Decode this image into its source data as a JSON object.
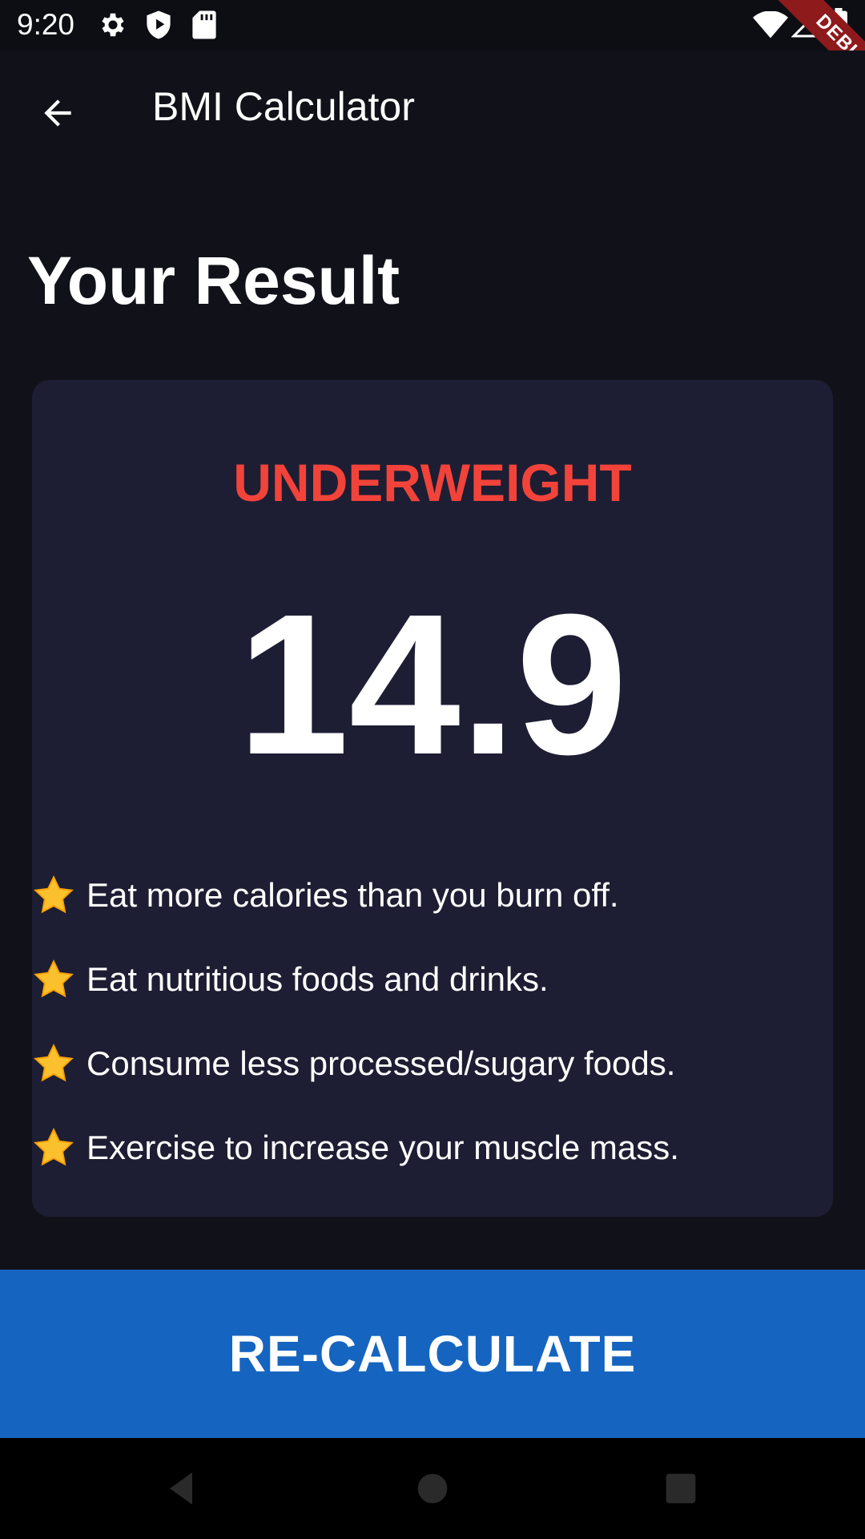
{
  "status_bar": {
    "time": "9:20",
    "left_icons": [
      "settings-icon",
      "shield-icon",
      "sd-card-icon"
    ],
    "right_icons": [
      "wifi-icon",
      "signal-icon",
      "battery-icon"
    ]
  },
  "debug_banner": {
    "label": "DEBUG",
    "color": "#8e1a1c"
  },
  "app_bar": {
    "back_icon": "arrow-back-icon",
    "title": "BMI Calculator"
  },
  "result": {
    "heading": "Your Result",
    "status": "UNDERWEIGHT",
    "status_color": "#f2433a",
    "bmi": "14.9",
    "advice": [
      {
        "icon": "star-icon",
        "text": "Eat more calories than you burn off."
      },
      {
        "icon": "star-icon",
        "text": "Eat nutritious foods and drinks."
      },
      {
        "icon": "star-icon",
        "text": "Consume less processed/sugary foods."
      },
      {
        "icon": "star-icon",
        "text": "Exercise to increase your muscle mass."
      }
    ]
  },
  "recalculate_button": {
    "label": "RE-CALCULATE",
    "color": "#1565c0"
  },
  "nav_bar": {
    "icons": [
      "nav-back-icon",
      "nav-home-icon",
      "nav-recents-icon"
    ]
  },
  "colors": {
    "background": "#111219",
    "card": "#1d1e33"
  }
}
